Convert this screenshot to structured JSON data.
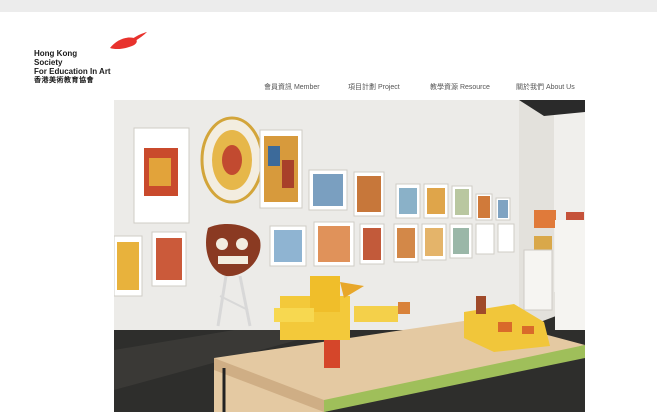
{
  "logo": {
    "name_en_line1": "Hong Kong",
    "name_en_line2": "Society",
    "name_en_line3": "For Education In Art",
    "name_zh": "香港美術教育協會",
    "mark_color": "#e8322d"
  },
  "nav": {
    "items": [
      {
        "label": "會員資訊 Member"
      },
      {
        "label": "項目計劃 Project"
      },
      {
        "label": "教學資源 Resource"
      },
      {
        "label": "關於我們 About Us"
      }
    ]
  },
  "hero": {
    "icon": "exhibition-photo"
  }
}
